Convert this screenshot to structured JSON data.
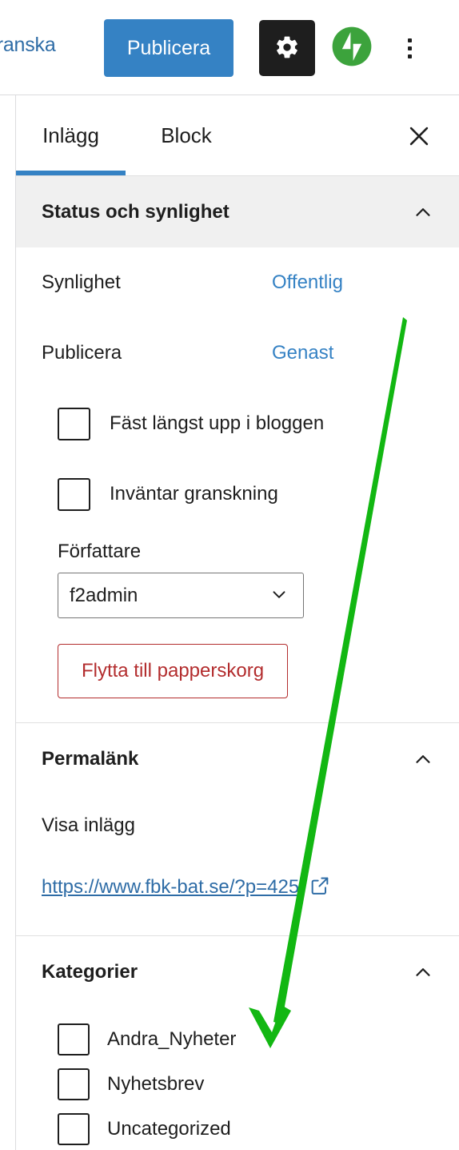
{
  "toolbar": {
    "preview_label": "granska",
    "publish_label": "Publicera",
    "settings_icon": "gear-icon",
    "jetpack_icon": "jetpack-icon",
    "more_icon": "kebab-menu-icon"
  },
  "sidebar": {
    "tabs": [
      {
        "label": "Inlägg",
        "active": true
      },
      {
        "label": "Block",
        "active": false
      }
    ],
    "close_icon": "close-icon",
    "panels": {
      "status": {
        "title": "Status och synlighet",
        "collapse_icon": "chevron-up-icon",
        "visibility": {
          "label": "Synlighet",
          "value": "Offentlig"
        },
        "publish": {
          "label": "Publicera",
          "value": "Genast"
        },
        "checkboxes": [
          {
            "label": "Fäst längst upp i bloggen",
            "checked": false
          },
          {
            "label": "Inväntar granskning",
            "checked": false
          }
        ],
        "author": {
          "label": "Författare",
          "value": "f2admin"
        },
        "trash_label": "Flytta till papperskorg"
      },
      "permalink": {
        "title": "Permalänk",
        "collapse_icon": "chevron-up-icon",
        "view_post_label": "Visa inlägg",
        "url": "https://www.fbk-bat.se/?p=425",
        "external_icon": "external-link-icon"
      },
      "categories": {
        "title": "Kategorier",
        "collapse_icon": "chevron-up-icon",
        "items": [
          {
            "label": "Andra_Nyheter",
            "checked": false
          },
          {
            "label": "Nyhetsbrev",
            "checked": false
          },
          {
            "label": "Uncategorized",
            "checked": false
          }
        ]
      }
    }
  },
  "annotation": {
    "type": "arrow",
    "color": "#12b712",
    "from": [
      504,
      398
    ],
    "to": [
      338,
      1307
    ]
  },
  "colors": {
    "accent_blue": "#3582c4",
    "link_blue": "#2e6ca6",
    "danger_red": "#b32d2e",
    "dark": "#1e1e1e",
    "panel_gray": "#f0f0f0",
    "jetpack_green": "#3ca33c",
    "annotation_green": "#12b712"
  }
}
